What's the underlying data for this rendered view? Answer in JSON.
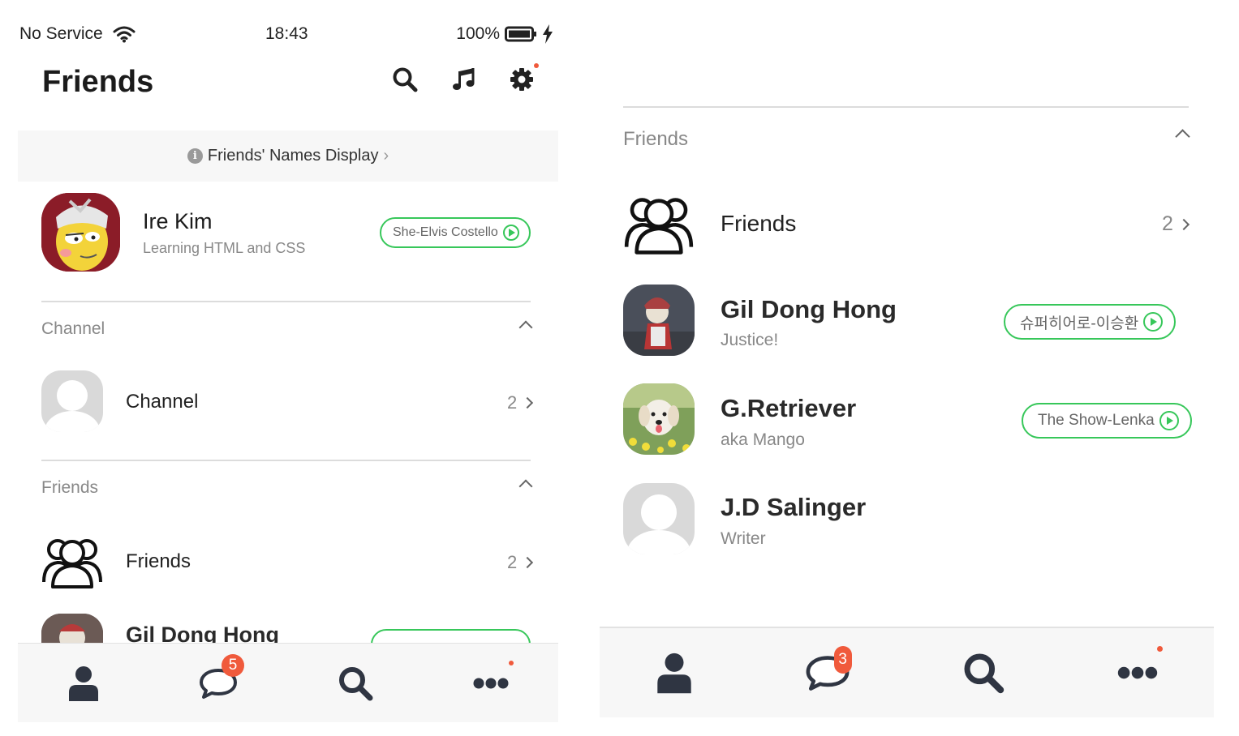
{
  "status_bar": {
    "carrier": "No Service",
    "time": "18:43",
    "battery": "100%"
  },
  "header": {
    "title": "Friends"
  },
  "names_display": {
    "label": "Friends' Names Display"
  },
  "profile": {
    "name": "Ire Kim",
    "status": "Learning HTML and CSS",
    "music": "She-Elvis Costello"
  },
  "channel_section": {
    "heading": "Channel",
    "row_label": "Channel",
    "row_count": "2"
  },
  "friends_section": {
    "heading": "Friends",
    "row_label": "Friends",
    "row_count": "2"
  },
  "left_peek": {
    "name": "Gil Dong Hong"
  },
  "friends": [
    {
      "name": "Gil Dong Hong",
      "status": "Justice!",
      "music": "슈퍼히어로-이승환"
    },
    {
      "name": "G.Retriever",
      "status": "aka Mango",
      "music": "The Show-Lenka"
    },
    {
      "name": "J.D Salinger",
      "status": "Writer"
    }
  ],
  "tab_bar": {
    "chat_badge_left": "5",
    "chat_badge_right": "3"
  },
  "colors": {
    "accent_green": "#37c75a",
    "badge_red": "#f05a3c",
    "tab_bg": "#f7f7f7",
    "icon_dark": "#2f3542"
  },
  "icons": [
    "wifi-icon",
    "battery-icon",
    "charging-icon",
    "search-icon",
    "music-icon",
    "gear-icon",
    "info-icon",
    "friends-group-icon",
    "person-icon",
    "chat-icon",
    "more-icon"
  ]
}
